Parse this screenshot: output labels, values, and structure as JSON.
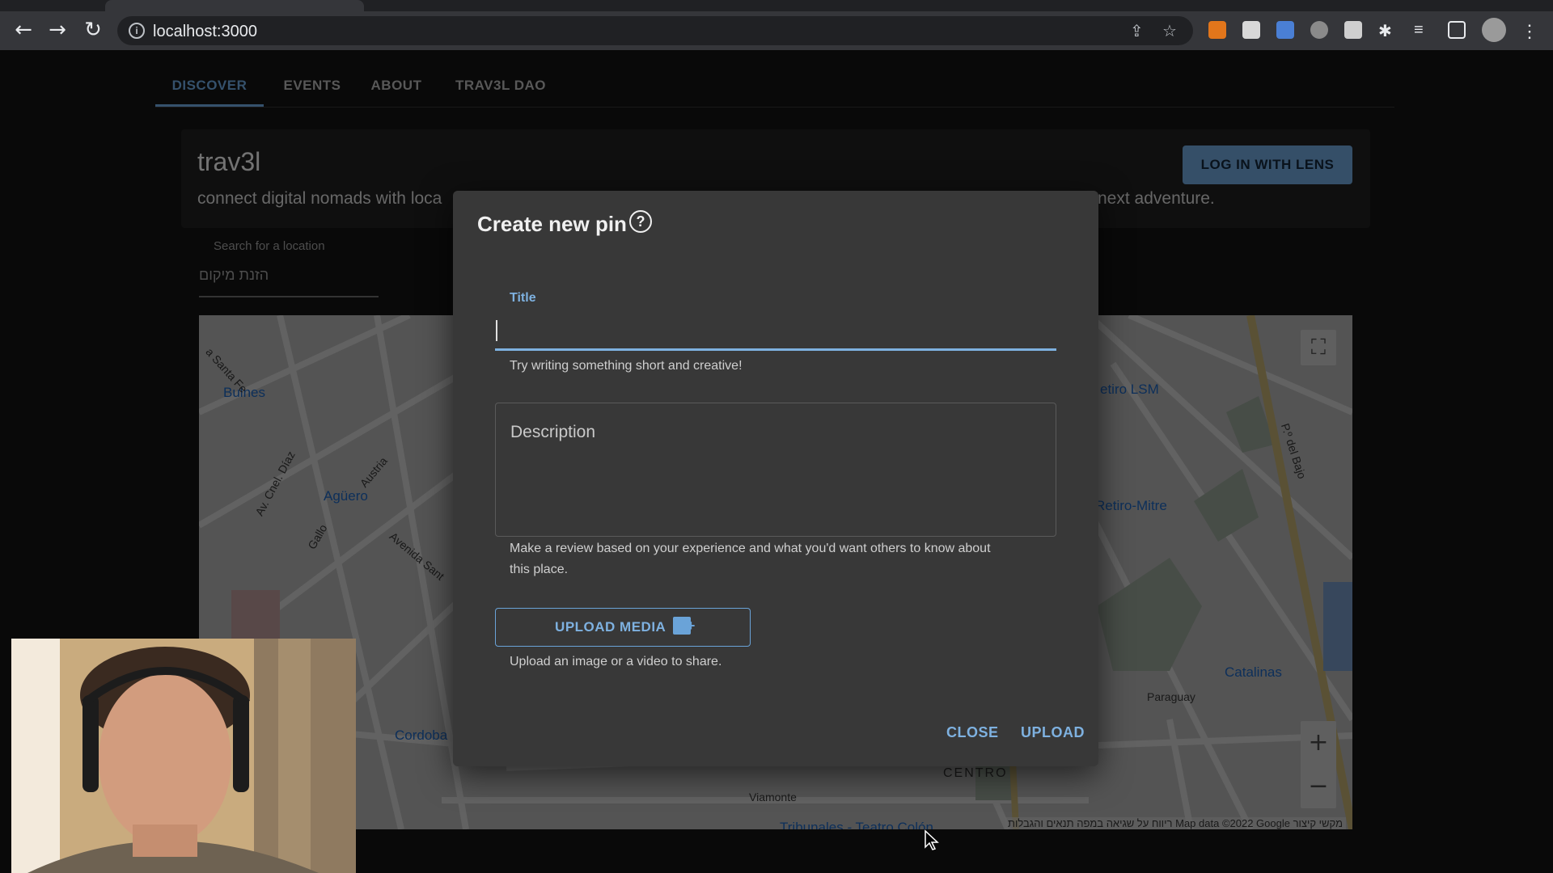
{
  "browser": {
    "url": "localhost:3000",
    "back_icon": "arrow-left-icon",
    "forward_icon": "arrow-right-icon",
    "reload_icon": "reload-icon",
    "info_icon": "info-icon",
    "info_symbol": "i"
  },
  "nav": {
    "tabs": [
      {
        "label": "DISCOVER",
        "active": true
      },
      {
        "label": "EVENTS",
        "active": false
      },
      {
        "label": "ABOUT",
        "active": false
      },
      {
        "label": "TRAV3L DAO",
        "active": false
      }
    ]
  },
  "hero": {
    "title": "trav3l",
    "subtitle_left": "connect digital nomads with loca",
    "subtitle_right": "next adventure.",
    "login_label": "LOG IN WITH LENS"
  },
  "search": {
    "label": "Search for a location",
    "placeholder": "הזנת מיקום"
  },
  "map": {
    "labels": {
      "bulnes": "Bulnes",
      "aguero": "Agüero",
      "cordoba": "Cordoba",
      "retiro_lsm": "etiro LSM",
      "retiro_mitre": "Retiro-Mitre",
      "catalinas": "Catalinas",
      "paraguay": "Paraguay",
      "centro": "CENTRO",
      "viamonte": "Viamonte",
      "tribunales": "Tribunales - Teatro Colón",
      "p_del_bajo": "P.º del Bajo",
      "av_cnel_diaz": "Av. Cnel. Díaz",
      "austria": "Austria",
      "avenida_santa": "Avenida Sant",
      "santa_fe": "a Santa Fe",
      "gallo": "Gallo"
    },
    "footer": "ריווח על שגיאה במפה  תנאים והגבלות  Map data ©2022 Google  מקשי קיצור",
    "zoom_in": "+",
    "zoom_out": "−",
    "fullscreen_icon": "fullscreen-icon"
  },
  "dialog": {
    "title": "Create new pin",
    "help_symbol": "?",
    "title_field": {
      "label": "Title",
      "value": "",
      "helper": "Try writing something short and creative!"
    },
    "description_field": {
      "placeholder": "Description",
      "helper_line1": "Make a review based on your experience and what you'd want others to know about",
      "helper_line2": "this place."
    },
    "upload_media": {
      "label": "UPLOAD MEDIA",
      "helper": "Upload an image or a video to share."
    },
    "actions": {
      "close": "CLOSE",
      "upload": "UPLOAD"
    }
  },
  "colors": {
    "accent": "#7eb1e0",
    "dialog_bg": "#383838",
    "page_bg": "#121212"
  }
}
